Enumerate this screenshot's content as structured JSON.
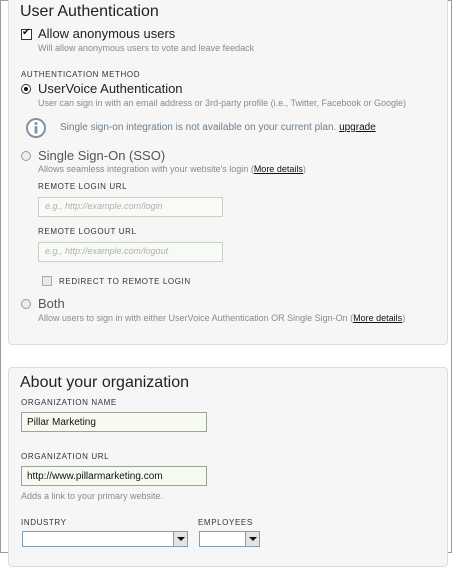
{
  "auth_section": {
    "title": "User Authentication",
    "anonymous": {
      "label": "Allow anonymous users",
      "hint": "Will allow anonymous users to vote and leave feedack",
      "checked": true
    },
    "method_heading": "AUTHENTICATION METHOD",
    "uservoice": {
      "label": "UserVoice Authentication",
      "hint": "User can sign in with an email address or 3rd-party profile (i.e., Twitter, Facebook or Google)",
      "selected": true
    },
    "notice": {
      "text": "Single sign-on integration is not available on your current plan.",
      "link": "upgrade",
      "icon": "info-icon"
    },
    "sso": {
      "label": "Single Sign-On (SSO)",
      "hint_prefix": "Allows seamless integration with your website's login (",
      "hint_link": "More details",
      "hint_suffix": ")",
      "selected": false
    },
    "remote_login": {
      "label": "REMOTE LOGIN URL",
      "placeholder": "e.g., http://example.com/login",
      "value": ""
    },
    "remote_logout": {
      "label": "REMOTE LOGOUT URL",
      "placeholder": "e.g., http://example.com/logout",
      "value": ""
    },
    "redirect": {
      "label": "REDIRECT TO REMOTE LOGIN",
      "checked": false
    },
    "both": {
      "label": "Both",
      "hint_prefix": "Allow users to sign in with either UserVoice Authentication OR Single Sign-On (",
      "hint_link": "More details",
      "hint_suffix": ")",
      "selected": false
    }
  },
  "org_section": {
    "title": "About your organization",
    "name": {
      "label": "ORGANIZATION NAME",
      "value": "Pillar Marketing"
    },
    "url": {
      "label": "ORGANIZATION URL",
      "value": "http://www.pillarmarketing.com",
      "hint": "Adds a link to your primary website."
    },
    "industry": {
      "label": "INDUSTRY",
      "value": ""
    },
    "employees": {
      "label": "EMPLOYEES",
      "value": ""
    }
  },
  "colors": {
    "panel_bg": "#f6f6f6",
    "info_icon": "#7f93a6",
    "input_bg": "#f7faf5"
  }
}
